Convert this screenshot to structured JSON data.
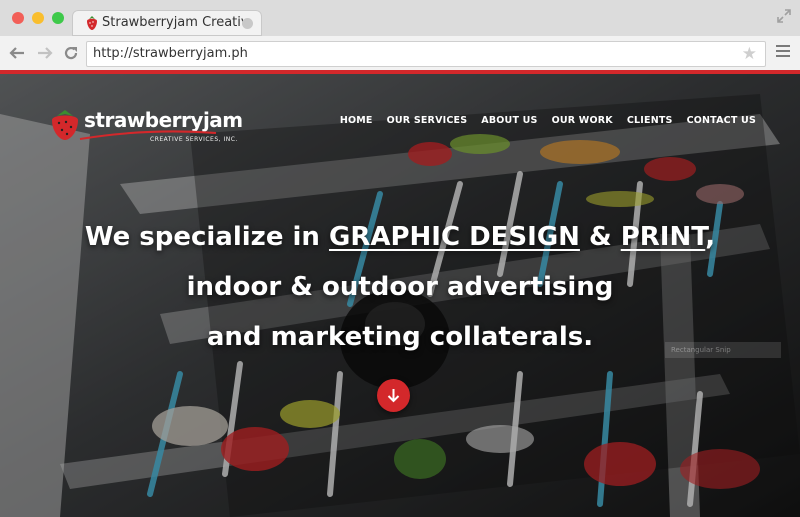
{
  "browser": {
    "tab_title": "Strawberryjam Creative",
    "url": "http://strawberryjam.ph"
  },
  "site": {
    "logo_name": "strawberryjam",
    "logo_sub": "CREATIVE SERVICES, INC.",
    "nav": [
      "HOME",
      "OUR SERVICES",
      "ABOUT US",
      "OUR WORK",
      "CLIENTS",
      "CONTACT US"
    ],
    "hero": {
      "prefix": "We specialize in ",
      "link1": "GRAPHIC DESIGN",
      "amp": " & ",
      "link2": "PRINT",
      "comma": ",",
      "line2": "indoor & outdoor advertising",
      "line3": "and marketing collaterals."
    },
    "faint_label": "Rectangular Snip"
  },
  "colors": {
    "accent": "#d3282b",
    "chrome_bg": "#dcdcdc"
  }
}
